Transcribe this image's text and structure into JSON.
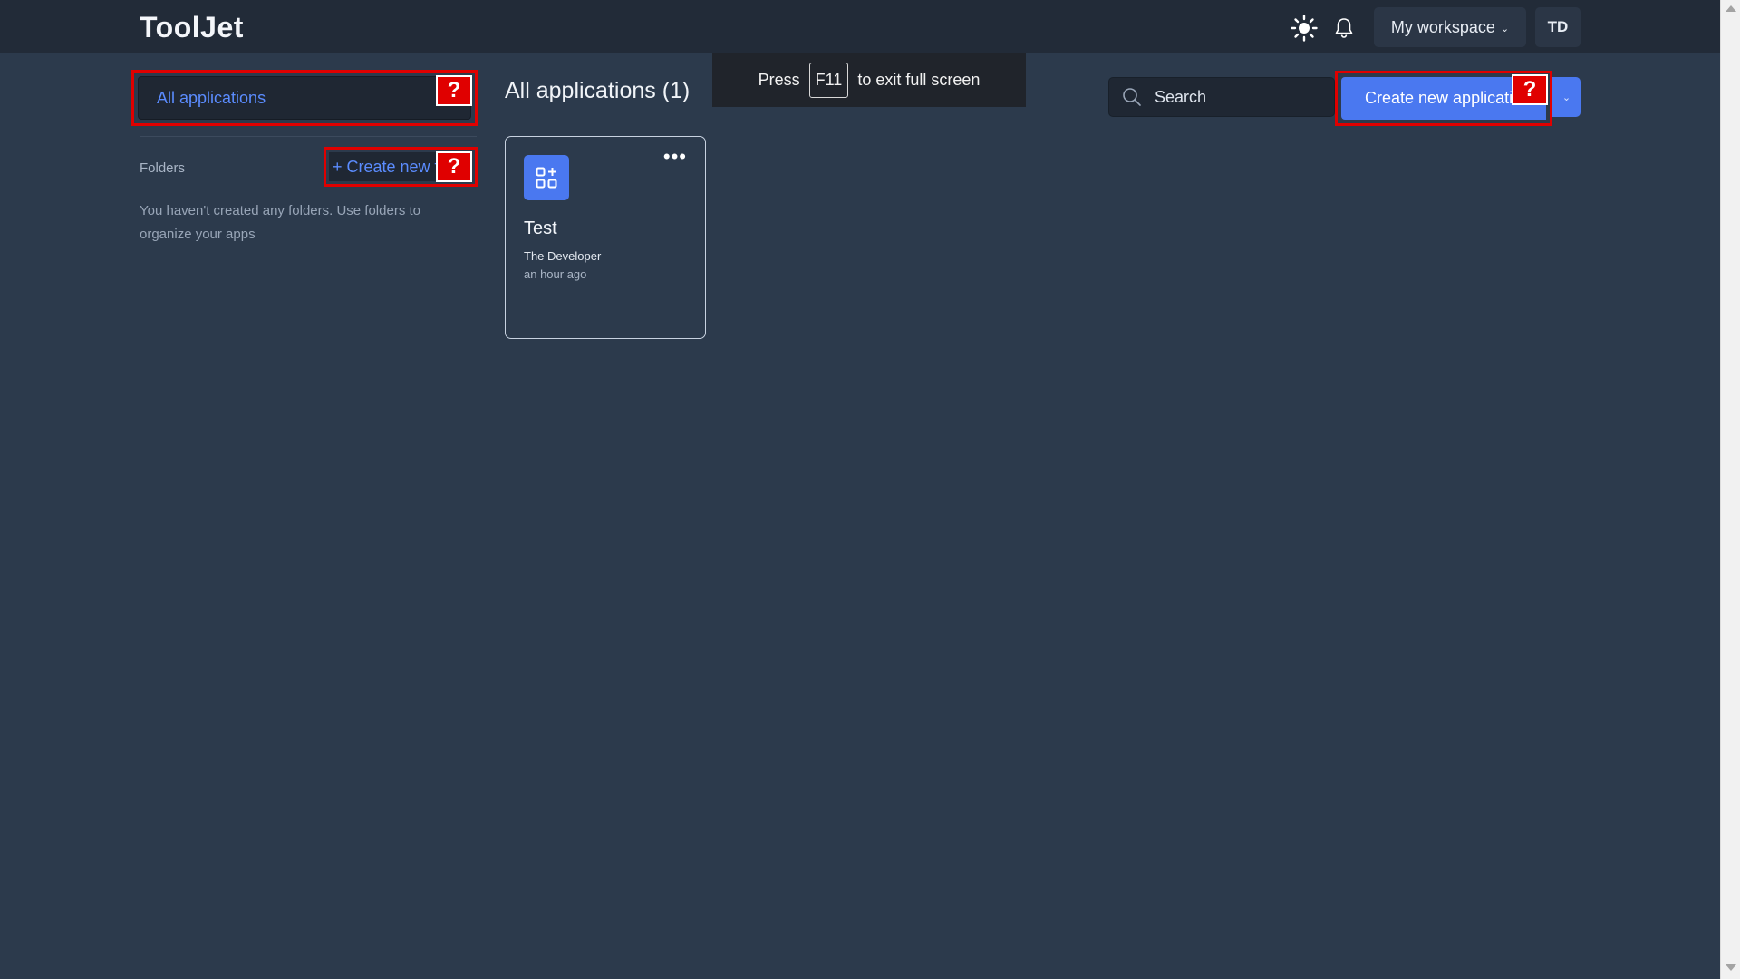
{
  "header": {
    "logo": "ToolJet",
    "theme_icon": "sun-icon",
    "notifications_icon": "bell-icon",
    "workspace_label": "My workspace",
    "workspace_chevron": "⌄",
    "avatar_initials": "TD"
  },
  "sidebar": {
    "all_applications_label": "All applications",
    "folders_label": "Folders",
    "create_folder_label": "+ Create new f",
    "empty_message": "You haven't created any folders. Use folders to organize your apps"
  },
  "main": {
    "title": "All applications (1)",
    "search": {
      "placeholder": "Search"
    },
    "create_app_label": "Create new applicatio",
    "create_app_dropdown": "⌄",
    "apps": [
      {
        "name": "Test",
        "owner": "The Developer",
        "updated": "an hour ago",
        "menu": "•••",
        "icon": "apps-grid-icon"
      }
    ]
  },
  "fullscreen_notice": {
    "prefix": "Press",
    "key": "F11",
    "suffix": "to exit full screen"
  },
  "annotation_badges": {
    "symbol": "?"
  },
  "colors": {
    "background": "#2c3a4c",
    "topbar": "#222b38",
    "accent": "#4a78f0",
    "link": "#5b8cff",
    "highlight": "#e00000"
  }
}
